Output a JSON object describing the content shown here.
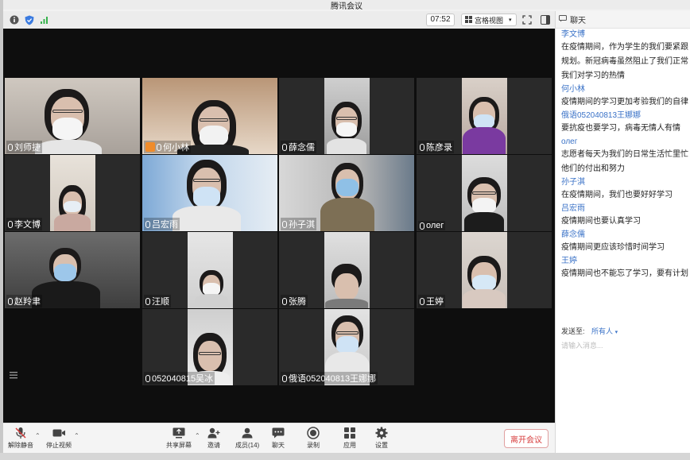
{
  "window": {
    "title": "腾讯会议"
  },
  "topbar": {
    "timer": "07:52",
    "view_mode": "宫格视图"
  },
  "participants": [
    "刘师捷",
    "何小林",
    "薛念儒",
    "陈彦录",
    "李文博",
    "吕宏雨",
    "孙子淇",
    "олег",
    "赵羚聿",
    "汪顺",
    "张腾",
    "王婷",
    "052040815吴冰",
    "俄语052040813王娜娜"
  ],
  "chat": {
    "header": "聊天",
    "messages": [
      {
        "name": "李文博",
        "lines": [
          "在疫情期间，作为学生的我们要紧跟",
          "规划。新冠病毒虽然阻止了我们正常",
          "我们对学习的热情"
        ]
      },
      {
        "name": "何小林",
        "lines": [
          "疫情期间的学习更加考验我们的自律"
        ]
      },
      {
        "name": "俄语052040813王娜娜",
        "lines": [
          "要抗疫也要学习，病毒无情人有情"
        ]
      },
      {
        "name": "олег",
        "lines": [
          "志愿者每天为我们的日常生活忙里忙",
          "他们的付出和努力"
        ]
      },
      {
        "name": "孙子淇",
        "lines": [
          "在疫情期间，我们也要好好学习"
        ]
      },
      {
        "name": "吕宏雨",
        "lines": [
          "疫情期间也要认真学习"
        ]
      },
      {
        "name": "薛念儒",
        "lines": [
          "疫情期间更应该珍惜时间学习"
        ]
      },
      {
        "name": "王婷",
        "lines": [
          "疫情期间也不能忘了学习，要有计划"
        ]
      }
    ],
    "send_to_label": "发送至:",
    "send_to_target": "所有人",
    "input_placeholder": "请输入消息..."
  },
  "toolbar": {
    "unmute": "解除静音",
    "stop_video": "停止视频",
    "share_screen": "共享屏幕",
    "invite": "邀请",
    "members": "成员(14)",
    "chat": "聊天",
    "record": "录制",
    "apps": "应用",
    "settings": "设置",
    "leave": "离开会议"
  },
  "colors": {
    "leave_text": "#d73b3b",
    "chat_name": "#3a72c7",
    "video_bg": "#0e0e0e"
  }
}
